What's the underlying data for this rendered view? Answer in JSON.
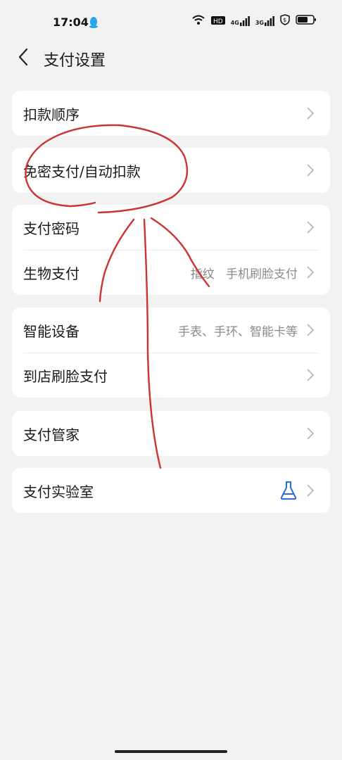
{
  "status": {
    "time": "17:04",
    "network_labels": [
      "4G",
      "3G"
    ]
  },
  "header": {
    "title": "支付设置"
  },
  "cards": [
    {
      "rows": [
        {
          "label": "扣款顺序",
          "value": ""
        }
      ]
    },
    {
      "rows": [
        {
          "label": "免密支付/自动扣款",
          "value": ""
        }
      ]
    },
    {
      "rows": [
        {
          "label": "支付密码",
          "value": ""
        },
        {
          "label": "生物支付",
          "value": "指纹   手机刷脸支付"
        }
      ]
    },
    {
      "rows": [
        {
          "label": "智能设备",
          "value": "手表、手环、智能卡等"
        },
        {
          "label": "到店刷脸支付",
          "value": ""
        }
      ]
    },
    {
      "rows": [
        {
          "label": "支付管家",
          "value": ""
        }
      ]
    },
    {
      "rows": [
        {
          "label": "支付实验室",
          "value": ""
        }
      ]
    }
  ],
  "colors": {
    "background": "#f2f2f2",
    "card": "#ffffff",
    "annotation": "#cc3333",
    "flask": "#2a6fd6"
  }
}
